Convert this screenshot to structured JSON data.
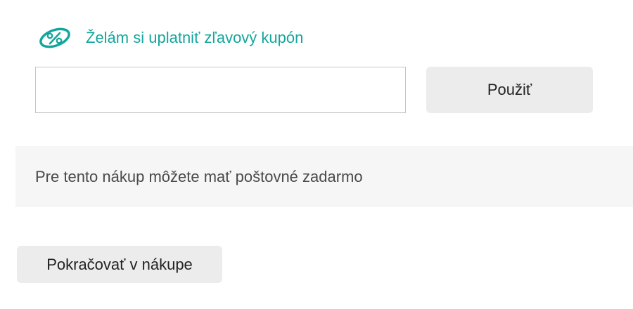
{
  "coupon": {
    "toggle_label": "Želám si uplatniť zľavový kupón",
    "input_value": "",
    "apply_label": "Použiť",
    "icon": "discount-percent-icon",
    "accent_color": "#14a69c"
  },
  "shipping": {
    "message": "Pre tento nákup môžete mať poštovné zadarmo"
  },
  "actions": {
    "continue_label": "Pokračovať v nákupe"
  }
}
